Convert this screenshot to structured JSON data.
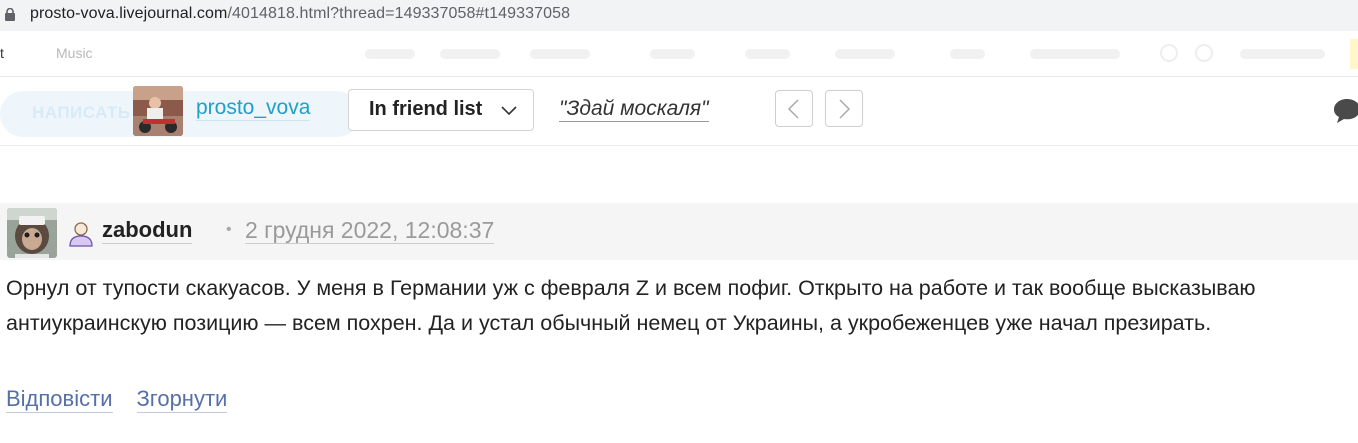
{
  "browser": {
    "url_host": "prosto-vova.livejournal.com",
    "url_path": "/4014818.html?thread=149337058#t149337058"
  },
  "navbar": {
    "left_fragment": "t",
    "music": "Music"
  },
  "journal": {
    "write_button": "НАПИСАТЬ",
    "username": "prosto_vova",
    "friend_button": "In friend list",
    "title": "\"Здай москаля\""
  },
  "comment": {
    "username": "zabodun",
    "date": "2 грудня 2022, 12:08:37",
    "text": "Орнул от тупости скакуасов. У меня в Германии уж с февраля Z и всем пофиг. Открыто на работе и так вообще высказываю антиукраинскую позицию — всем похрен. Да и устал обычный немец от Украины, а укробеженцев уже начал презирать.",
    "reply_label": "Відповісти",
    "collapse_label": "Згорнути"
  },
  "colors": {
    "link": "#1fa0c8",
    "action_link": "#5570a8"
  }
}
